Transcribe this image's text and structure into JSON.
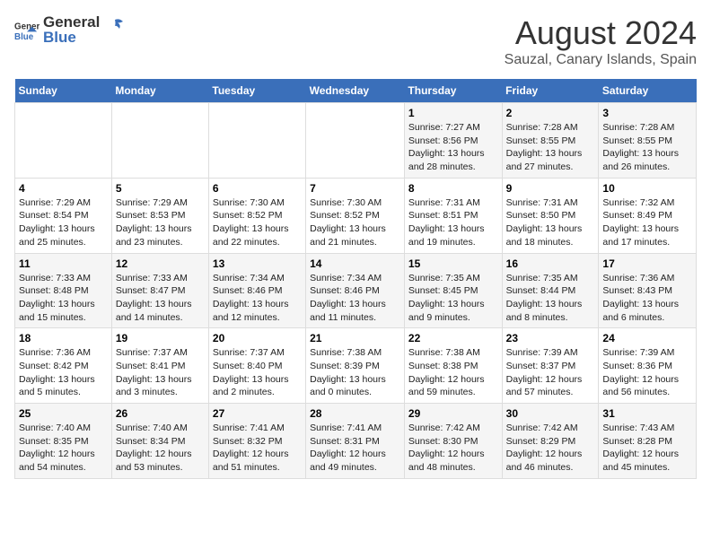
{
  "header": {
    "logo_general": "General",
    "logo_blue": "Blue",
    "main_title": "August 2024",
    "subtitle": "Sauzal, Canary Islands, Spain"
  },
  "calendar": {
    "days_of_week": [
      "Sunday",
      "Monday",
      "Tuesday",
      "Wednesday",
      "Thursday",
      "Friday",
      "Saturday"
    ],
    "weeks": [
      [
        {
          "day": "",
          "details": ""
        },
        {
          "day": "",
          "details": ""
        },
        {
          "day": "",
          "details": ""
        },
        {
          "day": "",
          "details": ""
        },
        {
          "day": "1",
          "details": "Sunrise: 7:27 AM\nSunset: 8:56 PM\nDaylight: 13 hours\nand 28 minutes."
        },
        {
          "day": "2",
          "details": "Sunrise: 7:28 AM\nSunset: 8:55 PM\nDaylight: 13 hours\nand 27 minutes."
        },
        {
          "day": "3",
          "details": "Sunrise: 7:28 AM\nSunset: 8:55 PM\nDaylight: 13 hours\nand 26 minutes."
        }
      ],
      [
        {
          "day": "4",
          "details": "Sunrise: 7:29 AM\nSunset: 8:54 PM\nDaylight: 13 hours\nand 25 minutes."
        },
        {
          "day": "5",
          "details": "Sunrise: 7:29 AM\nSunset: 8:53 PM\nDaylight: 13 hours\nand 23 minutes."
        },
        {
          "day": "6",
          "details": "Sunrise: 7:30 AM\nSunset: 8:52 PM\nDaylight: 13 hours\nand 22 minutes."
        },
        {
          "day": "7",
          "details": "Sunrise: 7:30 AM\nSunset: 8:52 PM\nDaylight: 13 hours\nand 21 minutes."
        },
        {
          "day": "8",
          "details": "Sunrise: 7:31 AM\nSunset: 8:51 PM\nDaylight: 13 hours\nand 19 minutes."
        },
        {
          "day": "9",
          "details": "Sunrise: 7:31 AM\nSunset: 8:50 PM\nDaylight: 13 hours\nand 18 minutes."
        },
        {
          "day": "10",
          "details": "Sunrise: 7:32 AM\nSunset: 8:49 PM\nDaylight: 13 hours\nand 17 minutes."
        }
      ],
      [
        {
          "day": "11",
          "details": "Sunrise: 7:33 AM\nSunset: 8:48 PM\nDaylight: 13 hours\nand 15 minutes."
        },
        {
          "day": "12",
          "details": "Sunrise: 7:33 AM\nSunset: 8:47 PM\nDaylight: 13 hours\nand 14 minutes."
        },
        {
          "day": "13",
          "details": "Sunrise: 7:34 AM\nSunset: 8:46 PM\nDaylight: 13 hours\nand 12 minutes."
        },
        {
          "day": "14",
          "details": "Sunrise: 7:34 AM\nSunset: 8:46 PM\nDaylight: 13 hours\nand 11 minutes."
        },
        {
          "day": "15",
          "details": "Sunrise: 7:35 AM\nSunset: 8:45 PM\nDaylight: 13 hours\nand 9 minutes."
        },
        {
          "day": "16",
          "details": "Sunrise: 7:35 AM\nSunset: 8:44 PM\nDaylight: 13 hours\nand 8 minutes."
        },
        {
          "day": "17",
          "details": "Sunrise: 7:36 AM\nSunset: 8:43 PM\nDaylight: 13 hours\nand 6 minutes."
        }
      ],
      [
        {
          "day": "18",
          "details": "Sunrise: 7:36 AM\nSunset: 8:42 PM\nDaylight: 13 hours\nand 5 minutes."
        },
        {
          "day": "19",
          "details": "Sunrise: 7:37 AM\nSunset: 8:41 PM\nDaylight: 13 hours\nand 3 minutes."
        },
        {
          "day": "20",
          "details": "Sunrise: 7:37 AM\nSunset: 8:40 PM\nDaylight: 13 hours\nand 2 minutes."
        },
        {
          "day": "21",
          "details": "Sunrise: 7:38 AM\nSunset: 8:39 PM\nDaylight: 13 hours\nand 0 minutes."
        },
        {
          "day": "22",
          "details": "Sunrise: 7:38 AM\nSunset: 8:38 PM\nDaylight: 12 hours\nand 59 minutes."
        },
        {
          "day": "23",
          "details": "Sunrise: 7:39 AM\nSunset: 8:37 PM\nDaylight: 12 hours\nand 57 minutes."
        },
        {
          "day": "24",
          "details": "Sunrise: 7:39 AM\nSunset: 8:36 PM\nDaylight: 12 hours\nand 56 minutes."
        }
      ],
      [
        {
          "day": "25",
          "details": "Sunrise: 7:40 AM\nSunset: 8:35 PM\nDaylight: 12 hours\nand 54 minutes."
        },
        {
          "day": "26",
          "details": "Sunrise: 7:40 AM\nSunset: 8:34 PM\nDaylight: 12 hours\nand 53 minutes."
        },
        {
          "day": "27",
          "details": "Sunrise: 7:41 AM\nSunset: 8:32 PM\nDaylight: 12 hours\nand 51 minutes."
        },
        {
          "day": "28",
          "details": "Sunrise: 7:41 AM\nSunset: 8:31 PM\nDaylight: 12 hours\nand 49 minutes."
        },
        {
          "day": "29",
          "details": "Sunrise: 7:42 AM\nSunset: 8:30 PM\nDaylight: 12 hours\nand 48 minutes."
        },
        {
          "day": "30",
          "details": "Sunrise: 7:42 AM\nSunset: 8:29 PM\nDaylight: 12 hours\nand 46 minutes."
        },
        {
          "day": "31",
          "details": "Sunrise: 7:43 AM\nSunset: 8:28 PM\nDaylight: 12 hours\nand 45 minutes."
        }
      ]
    ]
  }
}
